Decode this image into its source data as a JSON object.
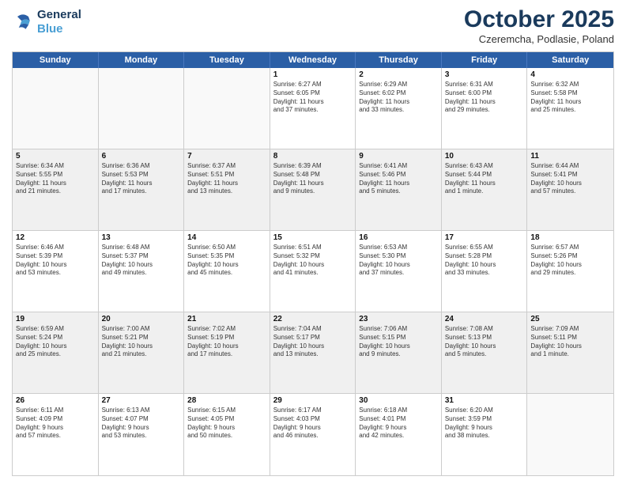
{
  "header": {
    "logo_line1": "General",
    "logo_line2": "Blue",
    "month": "October 2025",
    "location": "Czeremcha, Podlasie, Poland"
  },
  "days_of_week": [
    "Sunday",
    "Monday",
    "Tuesday",
    "Wednesday",
    "Thursday",
    "Friday",
    "Saturday"
  ],
  "weeks": [
    [
      {
        "num": "",
        "info": ""
      },
      {
        "num": "",
        "info": ""
      },
      {
        "num": "",
        "info": ""
      },
      {
        "num": "1",
        "info": "Sunrise: 6:27 AM\nSunset: 6:05 PM\nDaylight: 11 hours\nand 37 minutes."
      },
      {
        "num": "2",
        "info": "Sunrise: 6:29 AM\nSunset: 6:02 PM\nDaylight: 11 hours\nand 33 minutes."
      },
      {
        "num": "3",
        "info": "Sunrise: 6:31 AM\nSunset: 6:00 PM\nDaylight: 11 hours\nand 29 minutes."
      },
      {
        "num": "4",
        "info": "Sunrise: 6:32 AM\nSunset: 5:58 PM\nDaylight: 11 hours\nand 25 minutes."
      }
    ],
    [
      {
        "num": "5",
        "info": "Sunrise: 6:34 AM\nSunset: 5:55 PM\nDaylight: 11 hours\nand 21 minutes."
      },
      {
        "num": "6",
        "info": "Sunrise: 6:36 AM\nSunset: 5:53 PM\nDaylight: 11 hours\nand 17 minutes."
      },
      {
        "num": "7",
        "info": "Sunrise: 6:37 AM\nSunset: 5:51 PM\nDaylight: 11 hours\nand 13 minutes."
      },
      {
        "num": "8",
        "info": "Sunrise: 6:39 AM\nSunset: 5:48 PM\nDaylight: 11 hours\nand 9 minutes."
      },
      {
        "num": "9",
        "info": "Sunrise: 6:41 AM\nSunset: 5:46 PM\nDaylight: 11 hours\nand 5 minutes."
      },
      {
        "num": "10",
        "info": "Sunrise: 6:43 AM\nSunset: 5:44 PM\nDaylight: 11 hours\nand 1 minute."
      },
      {
        "num": "11",
        "info": "Sunrise: 6:44 AM\nSunset: 5:41 PM\nDaylight: 10 hours\nand 57 minutes."
      }
    ],
    [
      {
        "num": "12",
        "info": "Sunrise: 6:46 AM\nSunset: 5:39 PM\nDaylight: 10 hours\nand 53 minutes."
      },
      {
        "num": "13",
        "info": "Sunrise: 6:48 AM\nSunset: 5:37 PM\nDaylight: 10 hours\nand 49 minutes."
      },
      {
        "num": "14",
        "info": "Sunrise: 6:50 AM\nSunset: 5:35 PM\nDaylight: 10 hours\nand 45 minutes."
      },
      {
        "num": "15",
        "info": "Sunrise: 6:51 AM\nSunset: 5:32 PM\nDaylight: 10 hours\nand 41 minutes."
      },
      {
        "num": "16",
        "info": "Sunrise: 6:53 AM\nSunset: 5:30 PM\nDaylight: 10 hours\nand 37 minutes."
      },
      {
        "num": "17",
        "info": "Sunrise: 6:55 AM\nSunset: 5:28 PM\nDaylight: 10 hours\nand 33 minutes."
      },
      {
        "num": "18",
        "info": "Sunrise: 6:57 AM\nSunset: 5:26 PM\nDaylight: 10 hours\nand 29 minutes."
      }
    ],
    [
      {
        "num": "19",
        "info": "Sunrise: 6:59 AM\nSunset: 5:24 PM\nDaylight: 10 hours\nand 25 minutes."
      },
      {
        "num": "20",
        "info": "Sunrise: 7:00 AM\nSunset: 5:21 PM\nDaylight: 10 hours\nand 21 minutes."
      },
      {
        "num": "21",
        "info": "Sunrise: 7:02 AM\nSunset: 5:19 PM\nDaylight: 10 hours\nand 17 minutes."
      },
      {
        "num": "22",
        "info": "Sunrise: 7:04 AM\nSunset: 5:17 PM\nDaylight: 10 hours\nand 13 minutes."
      },
      {
        "num": "23",
        "info": "Sunrise: 7:06 AM\nSunset: 5:15 PM\nDaylight: 10 hours\nand 9 minutes."
      },
      {
        "num": "24",
        "info": "Sunrise: 7:08 AM\nSunset: 5:13 PM\nDaylight: 10 hours\nand 5 minutes."
      },
      {
        "num": "25",
        "info": "Sunrise: 7:09 AM\nSunset: 5:11 PM\nDaylight: 10 hours\nand 1 minute."
      }
    ],
    [
      {
        "num": "26",
        "info": "Sunrise: 6:11 AM\nSunset: 4:09 PM\nDaylight: 9 hours\nand 57 minutes."
      },
      {
        "num": "27",
        "info": "Sunrise: 6:13 AM\nSunset: 4:07 PM\nDaylight: 9 hours\nand 53 minutes."
      },
      {
        "num": "28",
        "info": "Sunrise: 6:15 AM\nSunset: 4:05 PM\nDaylight: 9 hours\nand 50 minutes."
      },
      {
        "num": "29",
        "info": "Sunrise: 6:17 AM\nSunset: 4:03 PM\nDaylight: 9 hours\nand 46 minutes."
      },
      {
        "num": "30",
        "info": "Sunrise: 6:18 AM\nSunset: 4:01 PM\nDaylight: 9 hours\nand 42 minutes."
      },
      {
        "num": "31",
        "info": "Sunrise: 6:20 AM\nSunset: 3:59 PM\nDaylight: 9 hours\nand 38 minutes."
      },
      {
        "num": "",
        "info": ""
      }
    ]
  ]
}
